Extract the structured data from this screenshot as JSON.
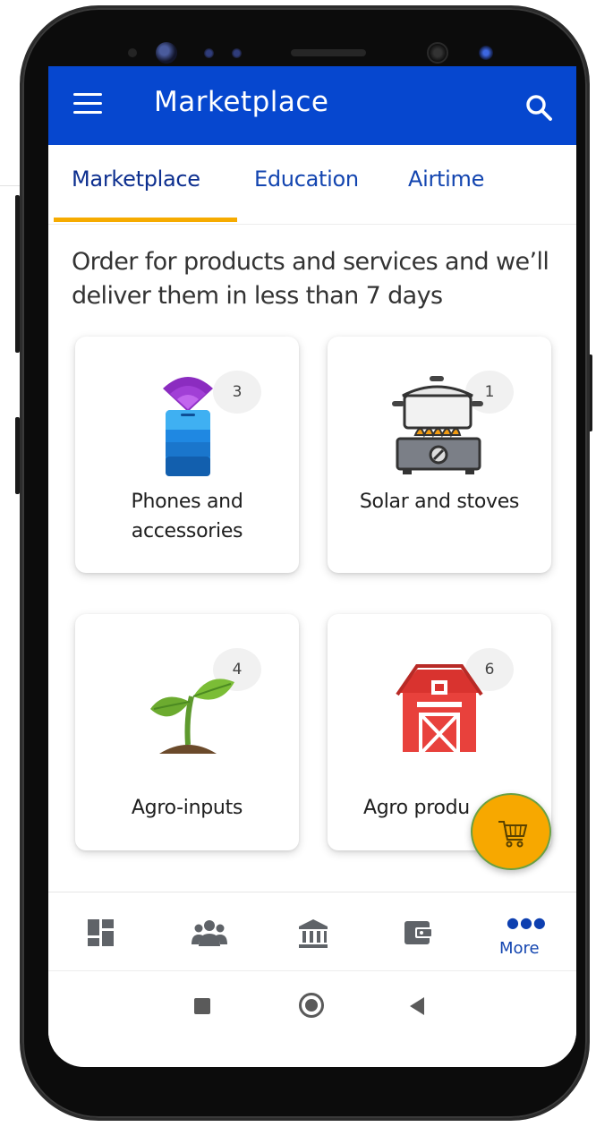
{
  "app_bar": {
    "title": "Marketplace"
  },
  "tabs": [
    {
      "label": "Marketplace",
      "selected": true
    },
    {
      "label": "Education"
    },
    {
      "label": "Airtime"
    }
  ],
  "intro_text": "Order for products and services and we’ll deliver them in less than 7 days",
  "categories": [
    {
      "label": "Phones and accessories",
      "count": "3",
      "icon": "phone-wifi-icon"
    },
    {
      "label": "Solar and stoves",
      "count": "1",
      "icon": "cooking-stove-icon"
    },
    {
      "label": "Agro-inputs",
      "count": "4",
      "icon": "seedling-icon"
    },
    {
      "label": "Agro produ",
      "count": "6",
      "icon": "barn-icon"
    }
  ],
  "fab": {
    "icon": "shopping-cart-icon"
  },
  "bottom_nav": {
    "items": [
      "dashboard-icon",
      "groups-icon",
      "bank-icon",
      "wallet-icon"
    ],
    "more_label": "More"
  },
  "colors": {
    "primary": "#0647cf",
    "accent": "#f6ab00",
    "tab_text": "#1345b0"
  }
}
